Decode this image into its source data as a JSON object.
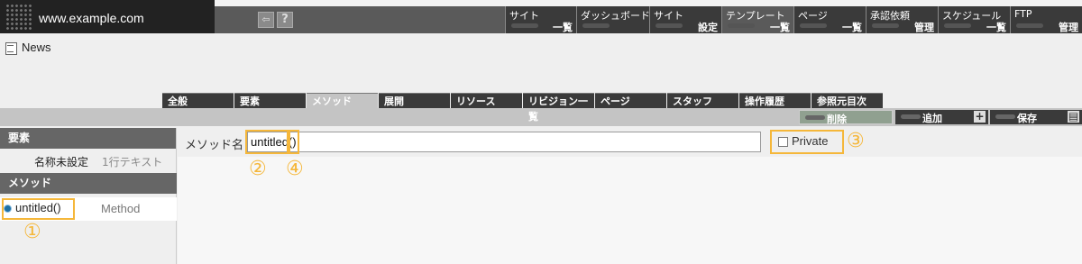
{
  "site": {
    "host": "www.example.com"
  },
  "header_icons": {
    "back": "back-arrow-icon",
    "help": "?"
  },
  "nav": [
    {
      "line1": "サイト",
      "line2": "一覧"
    },
    {
      "line1": "ダッシュボード",
      "line2": ""
    },
    {
      "line1": "サイト",
      "line2": "設定"
    },
    {
      "line1": "テンプレート",
      "line2": "一覧"
    },
    {
      "line1": "ページ",
      "line2": "一覧"
    },
    {
      "line1": "承認依頼",
      "line2": "管理"
    },
    {
      "line1": "スケジュール",
      "line2": "一覧"
    },
    {
      "line1": "FTP",
      "line2": "管理"
    }
  ],
  "page": {
    "title": "News"
  },
  "tabs": [
    "全般",
    "要素",
    "メソッド",
    "展開",
    "リソース",
    "リビジョン一覧",
    "ページ",
    "スタッフ",
    "操作履歴",
    "参照元目次"
  ],
  "actions": {
    "delete": "削除",
    "add": "追加",
    "save": "保存"
  },
  "sidebar": {
    "elements_header": "要素",
    "element": {
      "name": "名称未設定",
      "type": "1行テキスト"
    },
    "methods_header": "メソッド",
    "method": {
      "name": "untitled()",
      "kind": "Method"
    }
  },
  "editor": {
    "method_name_label": "メソッド名",
    "method_name_value": "untitled()",
    "private_label": "Private"
  },
  "markers": {
    "m1": "①",
    "m2": "②",
    "m3": "③",
    "m4": "④"
  },
  "colors": {
    "highlight": "#f5b73a",
    "dark": "#3a3a3a"
  }
}
